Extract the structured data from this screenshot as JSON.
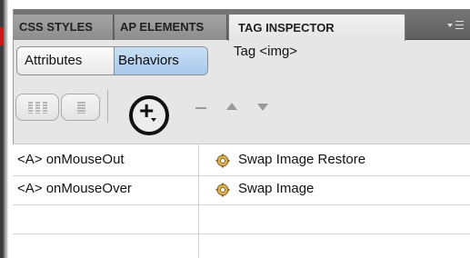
{
  "tabs": [
    {
      "label": "CSS STYLES"
    },
    {
      "label": "AP ELEMENTS"
    },
    {
      "label": "TAG INSPECTOR",
      "active": true
    }
  ],
  "panel_menu_icon": "panel-options-menu-icon",
  "mode_buttons": {
    "attributes_label": "Attributes",
    "behaviors_label": "Behaviors",
    "selected": "Behaviors"
  },
  "tag_label": "Tag <img>",
  "toolbar": {
    "icons": [
      "show-set-events-icon",
      "show-all-events-icon",
      "add-behavior-icon",
      "remove-behavior-icon",
      "move-up-icon",
      "move-down-icon"
    ],
    "add_symbol": "+"
  },
  "behaviors": [
    {
      "event": "<A> onMouseOut",
      "action": "Swap Image Restore",
      "icon": "behavior-gear-icon"
    },
    {
      "event": "<A> onMouseOver",
      "action": "Swap Image",
      "icon": "behavior-gear-icon"
    }
  ],
  "colors": {
    "active_segment": "#a9c8ea",
    "tab_bar": "#6a6a6a",
    "active_tab": "#eeeeee",
    "annotation_circle": "#111111"
  }
}
